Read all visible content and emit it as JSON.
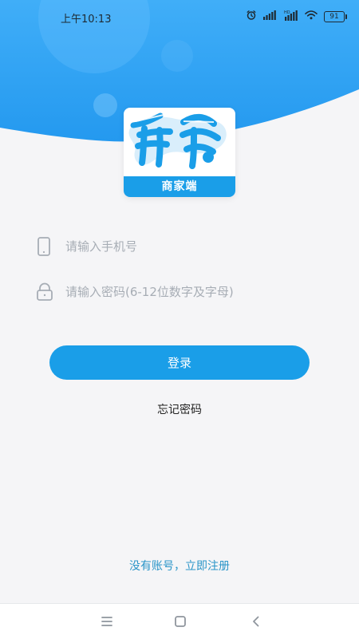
{
  "status_bar": {
    "time": "上午10:13",
    "battery": "91"
  },
  "logo": {
    "title": "箭岛",
    "subtitle": "商家端"
  },
  "form": {
    "phone_placeholder": "请输入手机号",
    "password_placeholder": "请输入密码(6-12位数字及字母)",
    "login_label": "登录",
    "forgot_label": "忘记密码",
    "register_label": "没有账号，立即注册"
  },
  "colors": {
    "accent": "#1a9ee8",
    "link": "#2a95c8",
    "background": "#f5f5f7"
  },
  "icons": {
    "phone": "phone-icon",
    "lock": "lock-icon",
    "menu": "menu-icon",
    "home": "home-icon",
    "back": "back-icon"
  }
}
